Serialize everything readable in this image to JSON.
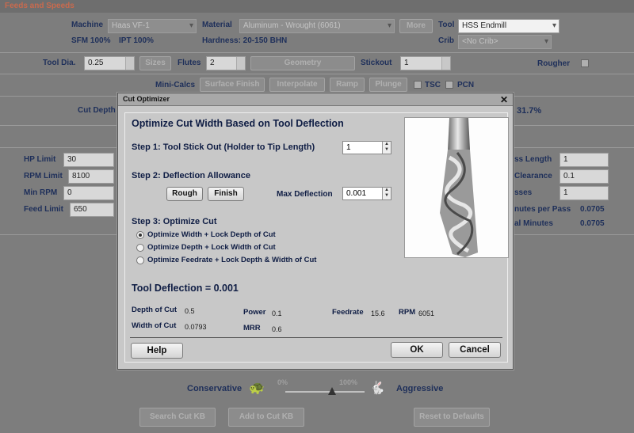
{
  "window": {
    "title": "Feeds and Speeds"
  },
  "row1": {
    "machine_label": "Machine",
    "machine_value": "Haas VF-1",
    "material_label": "Material",
    "material_value": "Aluminum - Wrought (6061)",
    "more_label": "More",
    "tool_label": "Tool",
    "tool_value": "HSS Endmill",
    "sfm": "SFM 100%",
    "ipt": "IPT 100%",
    "hardness": "Hardness: 20-150 BHN",
    "crib_label": "Crib",
    "crib_value": "<No Crib>"
  },
  "row2": {
    "tooldia_label": "Tool Dia.",
    "tooldia_value": "0.25",
    "sizes_label": "Sizes",
    "flutes_label": "Flutes",
    "flutes_value": "2",
    "geometry_label": "Geometry",
    "stickout_label": "Stickout",
    "stickout_value": "1",
    "rougher_label": "Rougher"
  },
  "minicalcs": {
    "label": "Mini-Calcs",
    "surface_finish": "Surface Finish",
    "interpolate": "Interpolate",
    "ramp": "Ramp",
    "plunge": "Plunge",
    "tsc": "TSC",
    "pcn": "PCN"
  },
  "cut": {
    "cut_depth_label": "Cut Depth",
    "pct": "31.7%"
  },
  "left_limits": {
    "hp_label": "HP Limit",
    "hp_value": "30",
    "rpm_label": "RPM Limit",
    "rpm_value": "8100",
    "minrpm_label": "Min RPM",
    "minrpm_value": "0",
    "feed_label": "Feed Limit",
    "feed_value": "650"
  },
  "right_partial": {
    "length_label": "ss Length",
    "length_value": "1",
    "clearance_label": "Clearance",
    "clearance_value": "0.1",
    "passes_label": "sses",
    "passes_value": "1",
    "mpp_label": "nutes per Pass",
    "mpp_value": "0.0705",
    "minutes_label": "al Minutes",
    "minutes_value": "0.0705"
  },
  "slider": {
    "conservative": "Conservative",
    "aggressive": "Aggressive",
    "min": "0%",
    "max": "100%"
  },
  "bottom_buttons": {
    "search": "Search Cut KB",
    "add": "Add to Cut KB",
    "reset": "Reset to Defaults"
  },
  "dialog": {
    "title": "Cut Optimizer",
    "heading": "Optimize Cut Width Based on Tool Deflection",
    "step1": "Step 1: Tool Stick Out (Holder to Tip Length)",
    "step1_value": "1",
    "step2": "Step 2: Deflection Allowance",
    "rough": "Rough",
    "finish": "Finish",
    "max_deflection_label": "Max Deflection",
    "max_deflection_value": "0.001",
    "step3": "Step 3: Optimize Cut",
    "options": [
      "Optimize Width + Lock Depth of Cut",
      "Optimize Depth + Lock Width of Cut",
      "Optimize Feedrate + Lock Depth & Width of Cut"
    ],
    "tool_deflection": "Tool Deflection = 0.001",
    "results": {
      "doc_label": "Depth of Cut",
      "doc_value": "0.5",
      "woc_label": "Width of Cut",
      "woc_value": "0.0793",
      "power_label": "Power",
      "power_value": "0.1",
      "mrr_label": "MRR",
      "mrr_value": "0.6",
      "feed_label": "Feedrate",
      "feed_value": "15.6",
      "rpm_label": "RPM",
      "rpm_value": "6051"
    },
    "help": "Help",
    "ok": "OK",
    "cancel": "Cancel"
  }
}
